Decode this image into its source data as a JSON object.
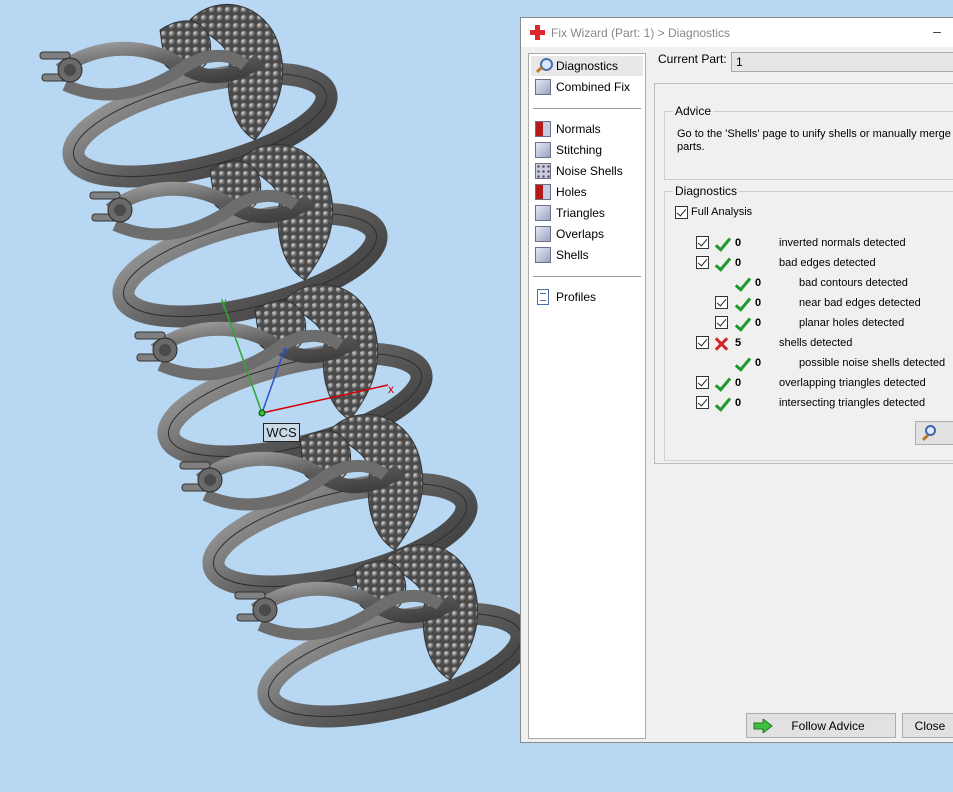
{
  "window": {
    "title": "Fix Wizard (Part: 1) > Diagnostics",
    "minimize_glyph": "–"
  },
  "viewport": {
    "wcs_label": "WCS",
    "axis_x": "x",
    "axis_y": "y",
    "axis_z": "z"
  },
  "sidebar": {
    "top_items": [
      {
        "label": "Diagnostics",
        "icon": "magnifier-icon",
        "active": true
      },
      {
        "label": "Combined Fix",
        "icon": "cube-icon"
      }
    ],
    "fix_items": [
      {
        "label": "Normals",
        "icon": "normals-cube-icon"
      },
      {
        "label": "Stitching",
        "icon": "stitching-cube-icon"
      },
      {
        "label": "Noise Shells",
        "icon": "noise-shells-cube-icon"
      },
      {
        "label": "Holes",
        "icon": "holes-cube-icon"
      },
      {
        "label": "Triangles",
        "icon": "triangles-cube-icon"
      },
      {
        "label": "Overlaps",
        "icon": "overlaps-cube-icon"
      },
      {
        "label": "Shells",
        "icon": "shells-cube-icon"
      }
    ],
    "bottom_items": [
      {
        "label": "Profiles",
        "icon": "document-icon"
      }
    ]
  },
  "current_part": {
    "label": "Current Part:",
    "value": "1"
  },
  "advice": {
    "title": "Advice",
    "text_line1": "Go to the 'Shells' page to unify shells or manually merge so",
    "text_line2": "parts."
  },
  "diagnostics": {
    "title": "Diagnostics",
    "full_analysis_label": "Full Analysis",
    "full_analysis_checked": true,
    "rows": [
      {
        "count": "0",
        "label": "inverted normals detected",
        "status": "ok",
        "indent": 0,
        "checkbox": true
      },
      {
        "count": "0",
        "label": "bad edges detected",
        "status": "ok",
        "indent": 0,
        "checkbox": true
      },
      {
        "count": "0",
        "label": "bad contours detected",
        "status": "ok",
        "indent": 1,
        "checkbox": false
      },
      {
        "count": "0",
        "label": "near bad edges detected",
        "status": "ok",
        "indent": 1,
        "checkbox": true
      },
      {
        "count": "0",
        "label": "planar holes detected",
        "status": "ok",
        "indent": 1,
        "checkbox": true
      },
      {
        "count": "5",
        "label": "shells detected",
        "status": "error",
        "indent": 0,
        "checkbox": true
      },
      {
        "count": "0",
        "label": "possible noise shells detected",
        "status": "ok",
        "indent": 1,
        "checkbox": false
      },
      {
        "count": "0",
        "label": "overlapping triangles detected",
        "status": "ok",
        "indent": 0,
        "checkbox": true
      },
      {
        "count": "0",
        "label": "intersecting triangles detected",
        "status": "ok",
        "indent": 0,
        "checkbox": true
      }
    ]
  },
  "buttons": {
    "follow_advice": "Follow Advice",
    "close": "Close"
  },
  "colors": {
    "viewport_bg": "#b7d7f2",
    "ok": "#1f9a2e",
    "error": "#d22525",
    "axis_x": "#d20000",
    "axis_y": "#2da82d",
    "axis_z": "#2b52c8"
  }
}
